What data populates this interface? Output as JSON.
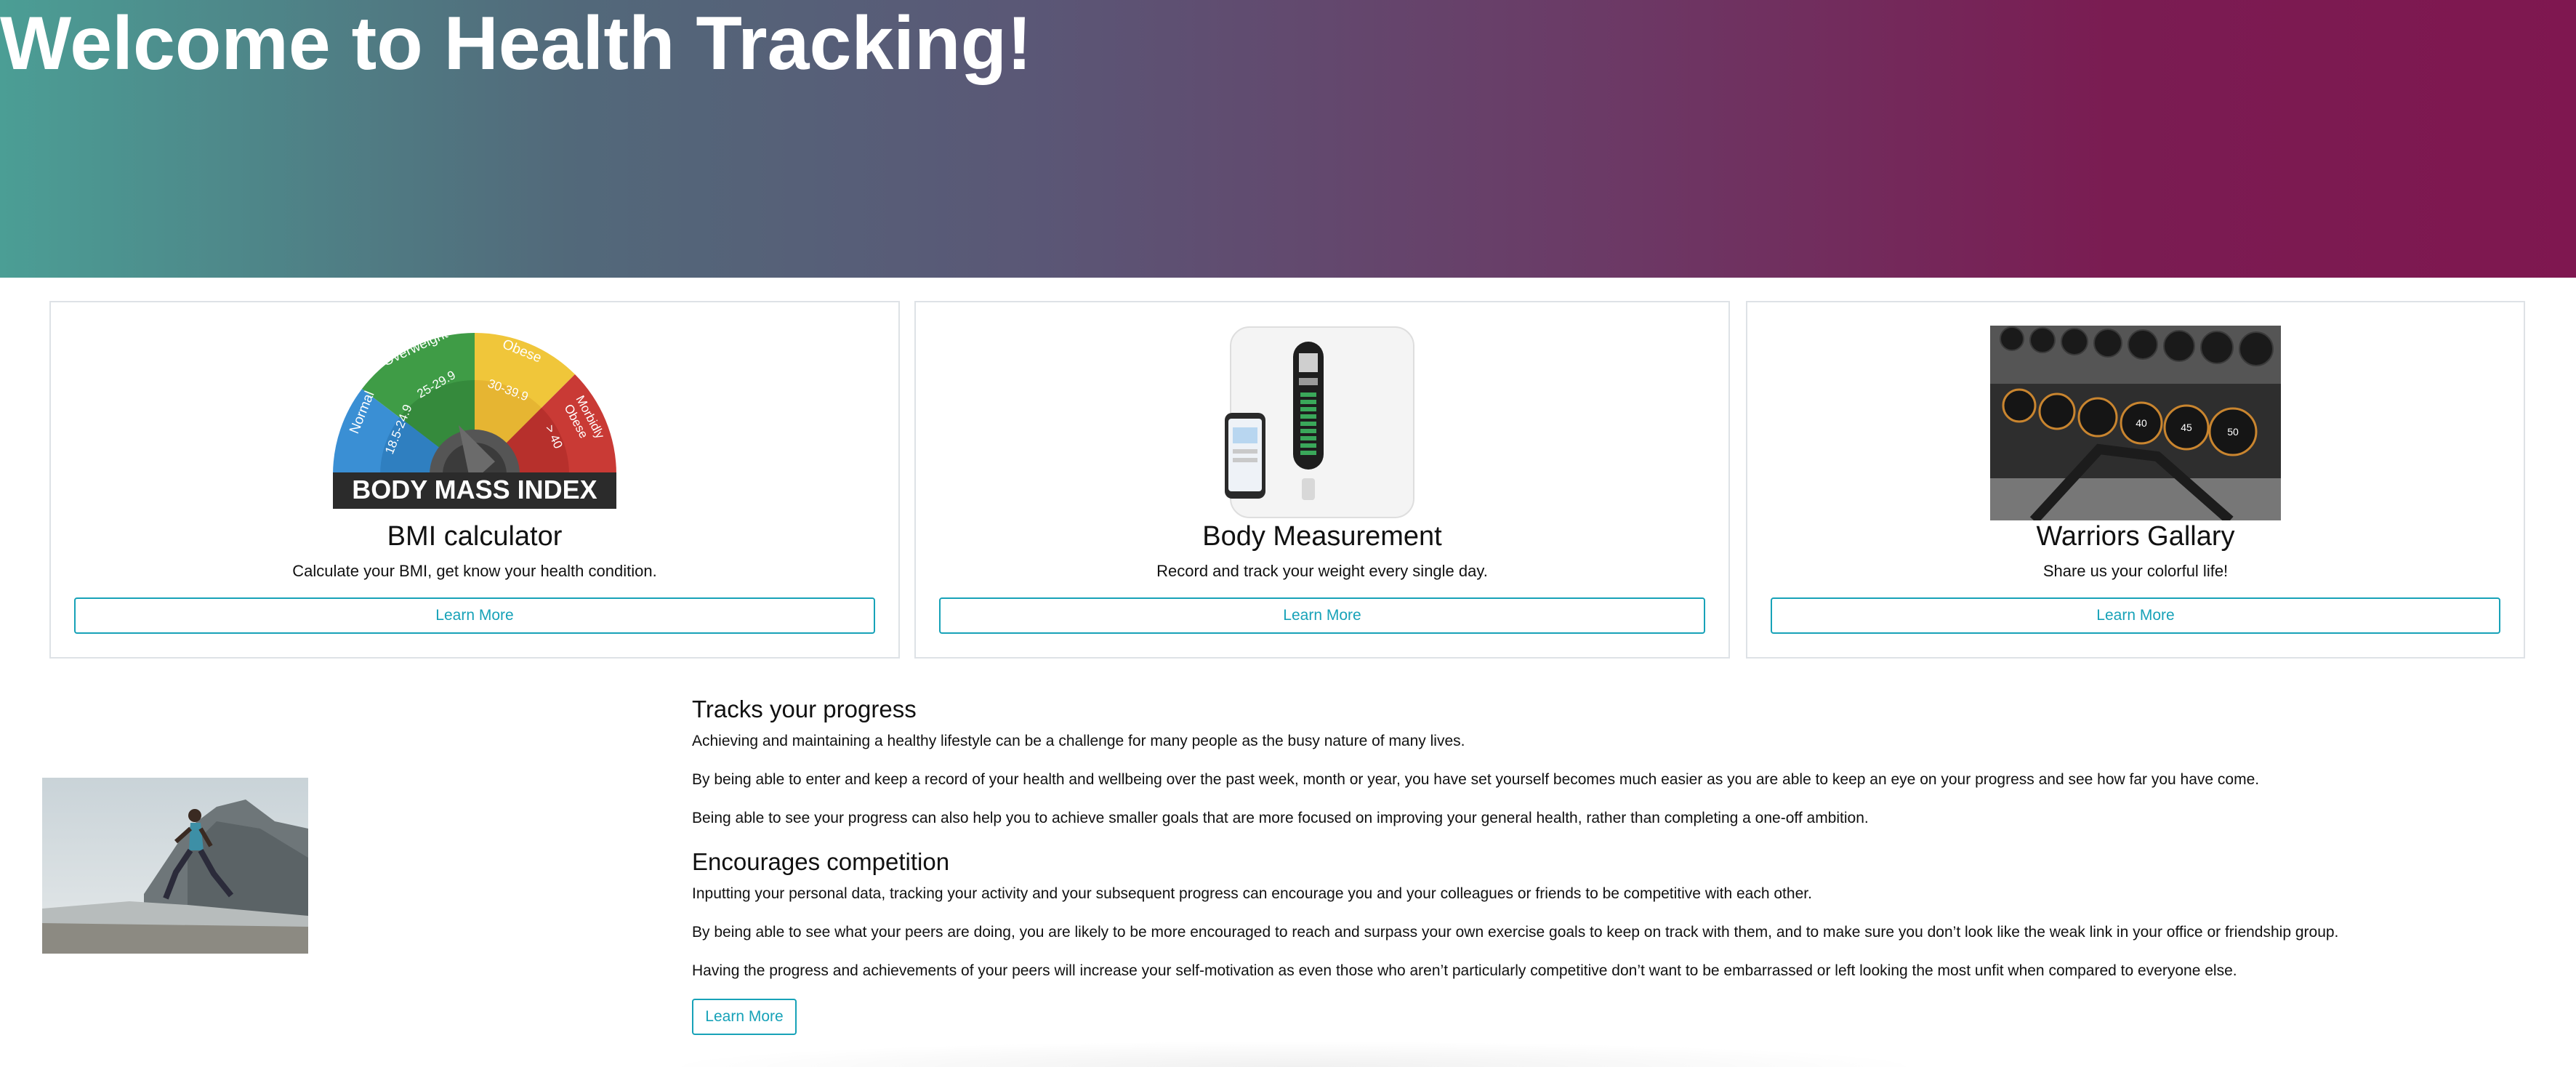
{
  "hero": {
    "title": "Welcome to Health Tracking!"
  },
  "cards": [
    {
      "title": "BMI calculator",
      "text": "Calculate your BMI, get know your health condition.",
      "button": "Learn More",
      "image": {
        "banner": "BODY MASS INDEX",
        "segments": [
          "Normal",
          "Overweight",
          "Obese",
          "Morbidly Obese"
        ],
        "ranges": [
          "18.5-24.9",
          "25-29.9",
          "30-39.9",
          "> 40"
        ]
      }
    },
    {
      "title": "Body Measurement",
      "text": "Record and track your weight every single day.",
      "button": "Learn More",
      "image": {
        "icon": "smart-scale-icon"
      }
    },
    {
      "title": "Warriors Gallary",
      "text": "Share us your colorful life!",
      "button": "Learn More",
      "image": {
        "icon": "dumbbell-rack-icon"
      }
    }
  ],
  "info": {
    "sections": [
      {
        "heading": "Tracks your progress",
        "paragraphs": [
          "Achieving and maintaining a healthy lifestyle can be a challenge for many people as the busy nature of many lives.",
          "By being able to enter and keep a record of your health and wellbeing over the past week, month or year, you have set yourself becomes much easier as you are able to keep an eye on your progress and see how far you have come.",
          "Being able to see your progress can also help you to achieve smaller goals that are more focused on improving your general health, rather than completing a one-off ambition."
        ]
      },
      {
        "heading": "Encourages competition",
        "paragraphs": [
          "Inputting your personal data, tracking your activity and your subsequent progress can encourage you and your colleagues or friends to be competitive with each other.",
          "By being able to see what your peers are doing, you are likely to be more encouraged to reach and surpass your own exercise goals to keep on track with them, and to make sure you don’t look like the weak link in your office or friendship group.",
          "Having the progress and achievements of your peers will increase your self-motivation as even those who aren’t particularly competitive don’t want to be embarrassed or left looking the most unfit when compared to everyone else."
        ]
      }
    ],
    "button": "Learn More",
    "image": {
      "icon": "runner-photo"
    }
  },
  "colors": {
    "accent": "#17a2b8",
    "hero_start": "#4b9e95",
    "hero_end": "#7f1750",
    "card_border": "#dee2e6"
  }
}
